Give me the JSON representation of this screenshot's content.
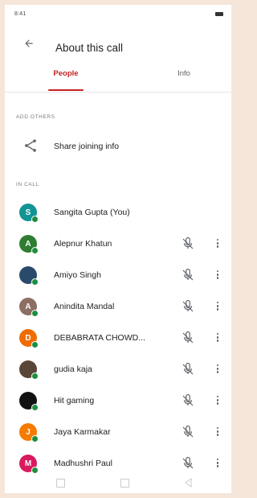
{
  "status_bar": {
    "time": "8:41"
  },
  "header": {
    "title": "About this call"
  },
  "tabs": [
    {
      "label": "People",
      "selected": true
    },
    {
      "label": "Info",
      "selected": false
    }
  ],
  "sections": {
    "add_others": "ADD OTHERS",
    "in_call": "IN CALL"
  },
  "share": {
    "label": "Share joining info",
    "icon": "share-icon"
  },
  "participants": [
    {
      "initial": "S",
      "name": "Sangita Gupta (You)",
      "avatar_color": "#139494",
      "muted": false,
      "more": false
    },
    {
      "initial": "A",
      "name": "Alepnur Khatun",
      "avatar_color": "#2e7d32",
      "muted": true,
      "more": true
    },
    {
      "initial": "",
      "name": "Amiyo Singh",
      "avatar_color": "#2a4a6b",
      "muted": true,
      "more": true
    },
    {
      "initial": "A",
      "name": "Anindita Mandal",
      "avatar_color": "#8d6e63",
      "muted": true,
      "more": true
    },
    {
      "initial": "D",
      "name": "DEBABRATA CHOWD...",
      "avatar_color": "#ef6c00",
      "muted": true,
      "more": true
    },
    {
      "initial": "",
      "name": "gudia kaja",
      "avatar_color": "#5a4636",
      "muted": true,
      "more": true
    },
    {
      "initial": "",
      "name": "Hit gaming",
      "avatar_color": "#111111",
      "muted": true,
      "more": true
    },
    {
      "initial": "J",
      "name": "Jaya Karmakar",
      "avatar_color": "#f57c00",
      "muted": true,
      "more": true
    },
    {
      "initial": "M",
      "name": "Madhushri Paul",
      "avatar_color": "#d81b60",
      "muted": true,
      "more": true
    }
  ],
  "colors": {
    "accent": "#c5221f",
    "online": "#1e8e3e"
  }
}
